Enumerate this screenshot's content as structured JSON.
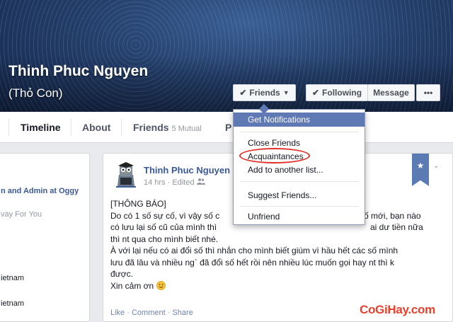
{
  "profile": {
    "name": "Thinh Phuc Nguyen",
    "alt_name": "(Thỏ Con)"
  },
  "cover_buttons": {
    "friends_label": "Friends",
    "following_label": "Following",
    "message_label": "Message",
    "more_label": "•••"
  },
  "nav": {
    "timeline": "Timeline",
    "about": "About",
    "friends": "Friends",
    "friends_mutual": "5 Mutual",
    "photos_partial": "P"
  },
  "left_column": {
    "line1": "n and Admin at Oggy",
    "line2": "vay For You",
    "line3": "ietnam",
    "line4": "ietnam"
  },
  "post": {
    "author": "Thinh Phuc Nguyen",
    "time": "14 hrs",
    "edited": "Edited",
    "body_lines": [
      "[THÔNG BÁO]",
      "Do có 1 số sự cố, vì vậy số c",
      "có lưu lại số cũ của mình thì",
      "thì nt qua cho mình biết nhé.",
      "À với lại nếu có ai đổi số thì nhắn cho mình biết giùm vì hầu hết các số mình",
      "lưu đã lâu và nhiều ng` đã đổi số hết rồi nên nhiều lúc muốn gọi hay nt thì k",
      "được.",
      "Xin cảm ơn"
    ],
    "body_line2_tail": "số mới, bạn nào",
    "body_line3_tail": "ai dư tiền nữa",
    "actions": {
      "like": "Like",
      "comment": "Comment",
      "share": "Share",
      "separator": "·"
    }
  },
  "friends_menu": {
    "items": [
      "Get Notifications",
      "Close Friends",
      "Acquaintances",
      "Add to another list...",
      "Suggest Friends...",
      "Unfriend"
    ]
  },
  "watermark": "CoGiHay.com",
  "colors": {
    "facebook_blue": "#3b5998",
    "menu_highlight": "#5f79b4",
    "annotation_red": "#e0302c"
  }
}
